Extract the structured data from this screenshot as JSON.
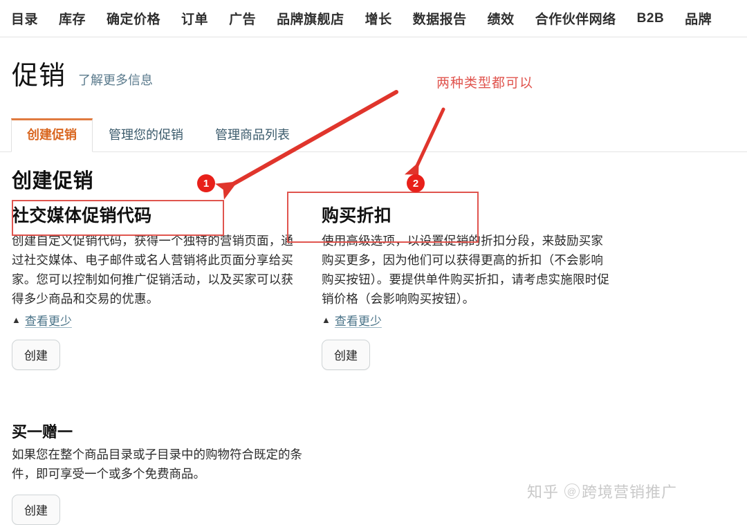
{
  "top_nav": {
    "items": [
      {
        "label": "目录"
      },
      {
        "label": "库存"
      },
      {
        "label": "确定价格"
      },
      {
        "label": "订单"
      },
      {
        "label": "广告"
      },
      {
        "label": "品牌旗舰店"
      },
      {
        "label": "增长"
      },
      {
        "label": "数据报告"
      },
      {
        "label": "绩效"
      },
      {
        "label": "合作伙伴网络"
      },
      {
        "label": "B2B"
      },
      {
        "label": "品牌"
      }
    ]
  },
  "header": {
    "title": "促销",
    "learn_more": "了解更多信息"
  },
  "tabs": [
    {
      "label": "创建促销",
      "active": true
    },
    {
      "label": "管理您的促销",
      "active": false
    },
    {
      "label": "管理商品列表",
      "active": false
    }
  ],
  "section": {
    "heading": "创建促销"
  },
  "cards": [
    {
      "id": "social-media-promo-code",
      "title": "社交媒体促销代码",
      "body": "创建自定义促销代码，获得一个独特的营销页面，通过社交媒体、电子邮件或名人营销将此页面分享给买家。您可以控制如何推广促销活动，以及买家可以获得多少商品和交易的优惠。",
      "see_less": "查看更少",
      "see_less_chevron": "chevron-up-icon",
      "create_button": "创建"
    },
    {
      "id": "quantity-discount",
      "title": "购买折扣",
      "body": "使用高级选项，以设置促销的折扣分段，来鼓励买家购买更多，因为他们可以获得更高的折扣（不会影响购买按钮）。要提供单件购买折扣，请考虑实施限时促销价格（会影响购买按钮）。",
      "see_less": "查看更少",
      "see_less_chevron": "chevron-up-icon",
      "create_button": "创建"
    }
  ],
  "bogo": {
    "title": "买一赠一",
    "body": "如果您在整个商品目录或子目录中的购物符合既定的条件，即可享受一个或多个免费商品。",
    "create_button": "创建"
  },
  "annotations": {
    "note": "两种类型都可以",
    "badge_1": "1",
    "badge_2": "2",
    "color": "#e0544e",
    "badge_color": "#e8201a"
  },
  "watermark": {
    "site": "知乎",
    "at": "@",
    "account": "跨境营销推广"
  },
  "colors": {
    "accent_orange": "#d9661f",
    "link_blue": "#4a7388",
    "annotation_red": "#e0544e",
    "page_bg": "#ffffff"
  }
}
